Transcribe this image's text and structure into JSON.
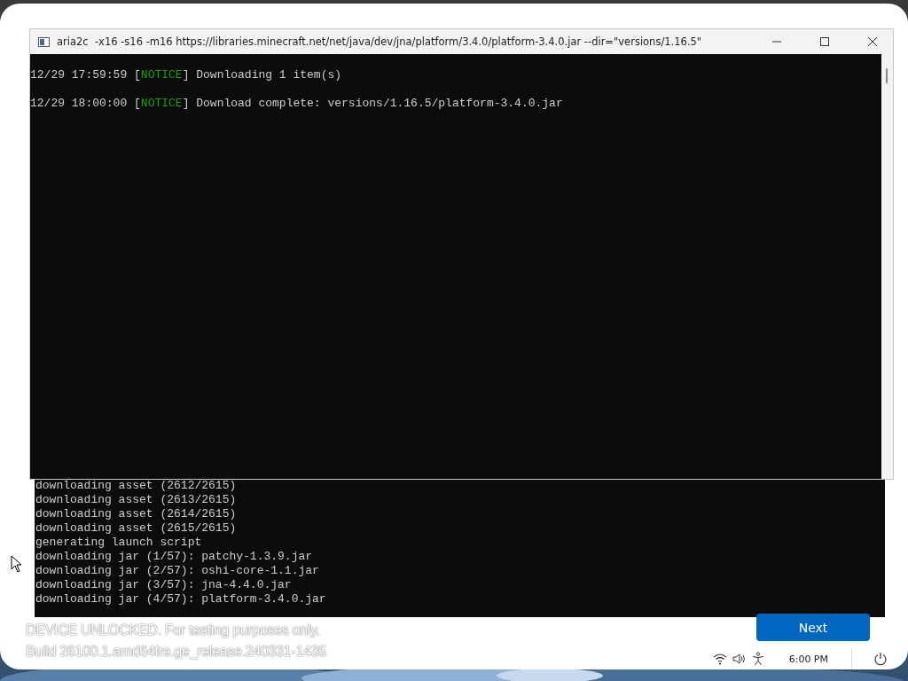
{
  "front_window": {
    "title": "aria2c  -x16 -s16 -m16 https://libraries.minecraft.net/net/java/dev/jna/platform/3.4.0/platform-3.4.0.jar --dir=\"versions/1.16.5\"",
    "lines": [
      {
        "before_tag": "12/29 17:59:59 [",
        "tag": "NOTICE",
        "after_tag": "] Downloading 1 item(s)"
      },
      {
        "before_tag": "12/29 18:00:00 [",
        "tag": "NOTICE",
        "after_tag": "] Download complete: versions/1.16.5/platform-3.4.0.jar"
      }
    ]
  },
  "back_console": {
    "lines": [
      "downloading asset (2612/2615)",
      "downloading asset (2613/2615)",
      "downloading asset (2614/2615)",
      "downloading asset (2615/2615)",
      "generating launch script",
      "downloading jar (1/57): patchy-1.3.9.jar",
      "downloading jar (2/57): oshi-core-1.1.jar",
      "downloading jar (3/57): jna-4.4.0.jar",
      "downloading jar (4/57): platform-3.4.0.jar"
    ]
  },
  "watermark_notice": [
    "DEVICE UNLOCKED. For testing purposes only.",
    "Build 26100.1.amd64fre.ge_release.240331-1435"
  ],
  "next_button": "Next",
  "tray": {
    "time": "6:00 PM"
  }
}
